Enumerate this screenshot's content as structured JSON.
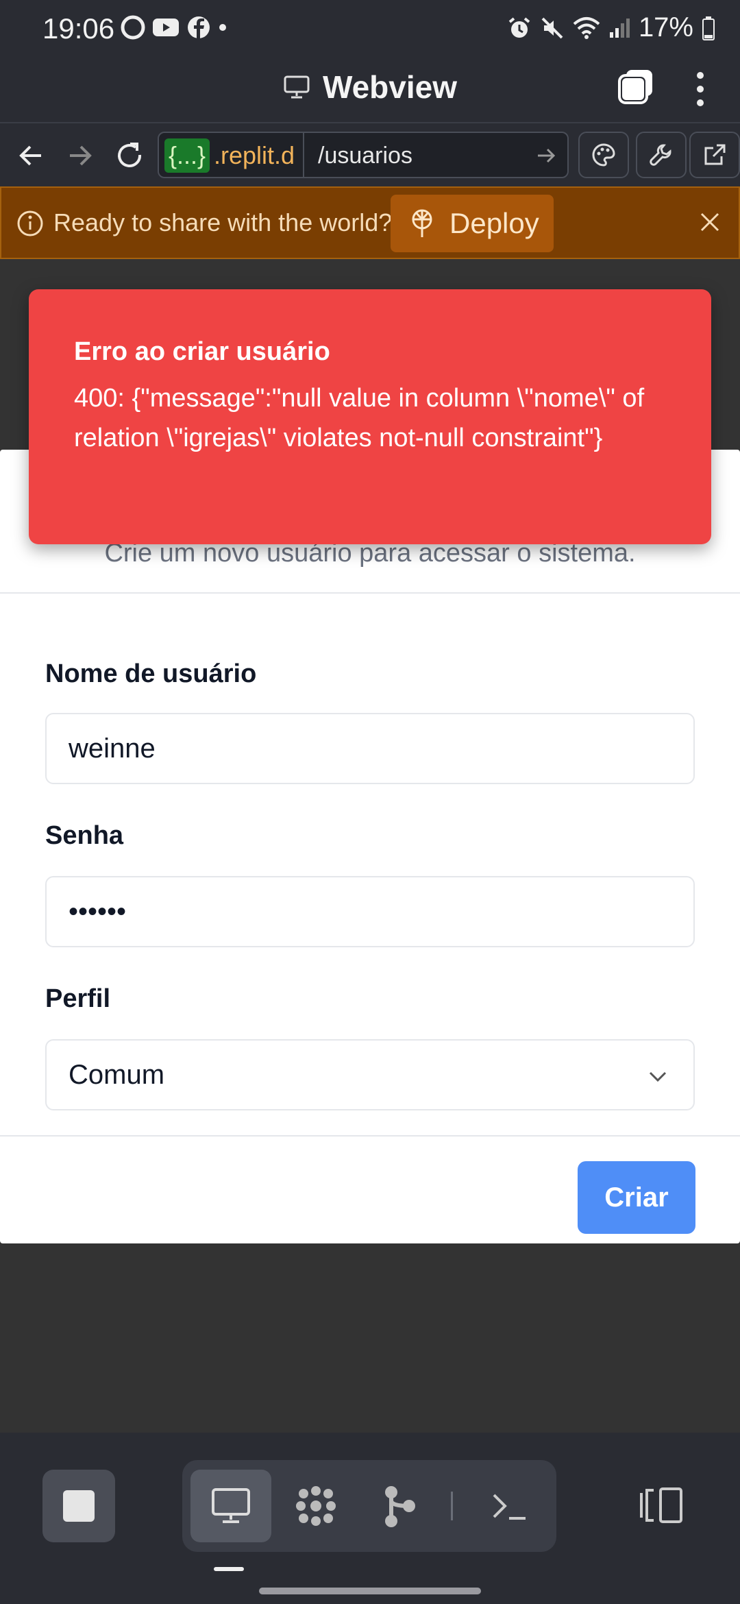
{
  "status_bar": {
    "time": "19:06",
    "battery": "17%",
    "icons": [
      "edge-icon",
      "youtube-icon",
      "facebook-icon",
      "dot-icon",
      "alarm-icon",
      "mute-icon",
      "wifi-icon",
      "signal-icon",
      "battery-icon"
    ]
  },
  "titlebar": {
    "title": "Webview"
  },
  "urlbar": {
    "host_pill": "{...}",
    "host": ".replit.d",
    "path": "/usuarios"
  },
  "banner": {
    "text": "Ready to share with the world?",
    "deploy_label": "Deploy",
    "bg_color": "#7a3e02"
  },
  "dialog": {
    "description": "Crie um novo usuário para acessar o sistema.",
    "username_label": "Nome de usuário",
    "username_value": "weinne",
    "password_label": "Senha",
    "password_value": "••••••",
    "profile_label": "Perfil",
    "profile_value": "Comum",
    "submit_label": "Criar",
    "accent_color": "#4f8ef7"
  },
  "toast": {
    "title": "Erro ao criar usuário",
    "message": "400: {\"message\":\"null value in column \\\"nome\\\" of relation \\\"igrejas\\\" violates not-null constraint\"}",
    "bg_color": "#ef4444"
  }
}
